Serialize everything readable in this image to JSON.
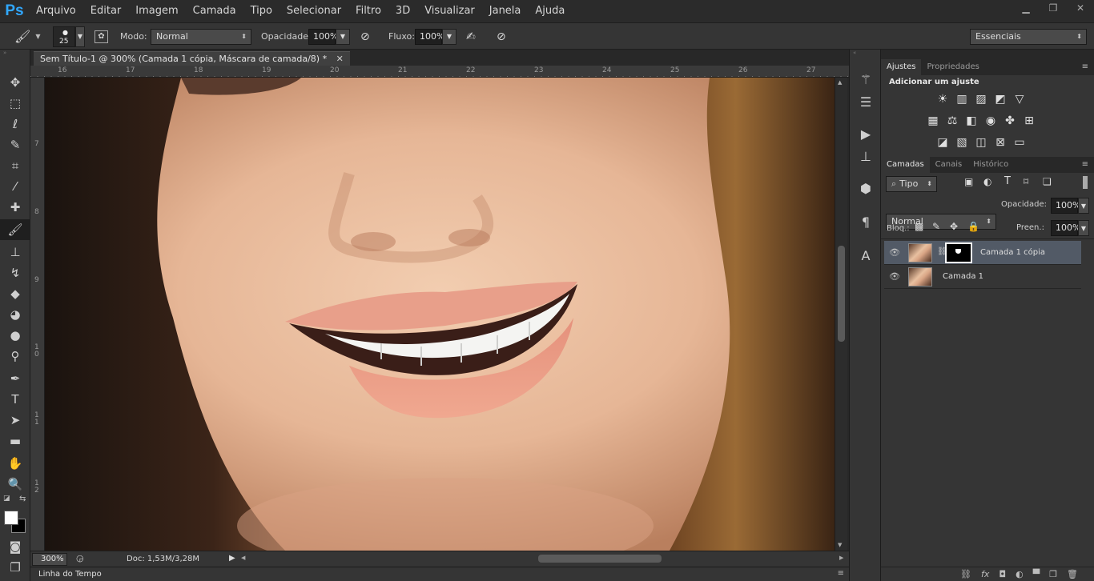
{
  "app": {
    "logo": "Ps"
  },
  "menu": [
    "Arquivo",
    "Editar",
    "Imagem",
    "Camada",
    "Tipo",
    "Selecionar",
    "Filtro",
    "3D",
    "Visualizar",
    "Janela",
    "Ajuda"
  ],
  "window_controls": [
    "minimize-icon",
    "restore-icon",
    "close-icon"
  ],
  "options": {
    "brush_size": "25",
    "mode_label": "Modo:",
    "mode_value": "Normal",
    "opacity_label": "Opacidade:",
    "opacity_value": "100%",
    "flow_label": "Fluxo:",
    "flow_value": "100%",
    "workspace": "Essenciais"
  },
  "document": {
    "tab_title": "Sem Título-1 @ 300% (Camada 1 cópia, Máscara de camada/8) *",
    "ruler_top": [
      "16",
      "17",
      "18",
      "19",
      "20",
      "21",
      "22",
      "23",
      "24",
      "25",
      "26",
      "27"
    ],
    "ruler_left": [
      "7",
      "8",
      "9",
      "1 0",
      "1 1",
      "1 2"
    ],
    "zoom": "300%",
    "doc_info": "Doc: 1,53M/3,28M"
  },
  "timeline": {
    "label": "Linha do Tempo"
  },
  "adjust_panel": {
    "tabs": [
      "Ajustes",
      "Propriedades"
    ],
    "heading": "Adicionar um ajuste"
  },
  "layers_panel": {
    "tabs": [
      "Camadas",
      "Canais",
      "Histórico"
    ],
    "filter_kind": "Tipo",
    "blend_mode": "Normal",
    "opacity_label": "Opacidade:",
    "opacity_value": "100%",
    "lock_label": "Bloq.:",
    "fill_label": "Preen.:",
    "fill_value": "100%",
    "layers": [
      {
        "name": "Camada 1 cópia",
        "selected": true,
        "has_mask": true
      },
      {
        "name": "Camada 1",
        "selected": false,
        "has_mask": false
      }
    ]
  },
  "colors": {
    "accent": "#31a8ff",
    "selected_layer": "#525a66"
  }
}
